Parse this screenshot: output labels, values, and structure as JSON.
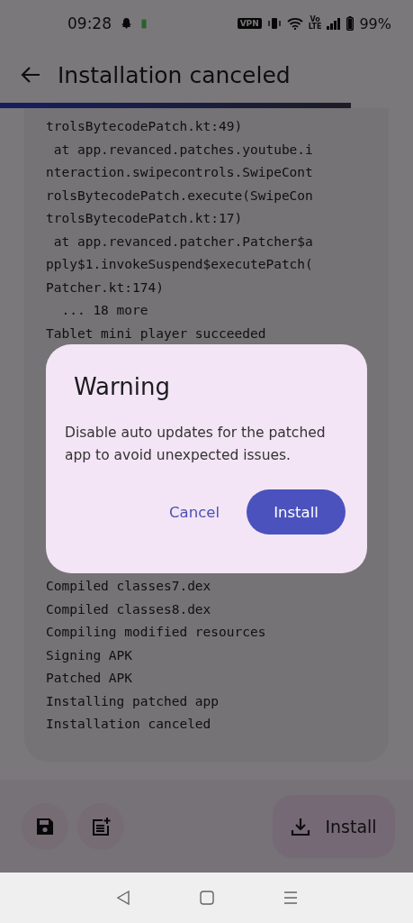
{
  "status_bar": {
    "time": "09:28",
    "vpn": "VPN",
    "volte": "Vo\nLTE",
    "battery": "99%"
  },
  "app_bar": {
    "title": "Installation canceled"
  },
  "progress": {
    "level": 0.85
  },
  "log": {
    "lines_above": [
      "trolsBytecodePatch.kt:49)",
      " at app.revanced.patches.youtube.i",
      "nteraction.swipecontrols.SwipeCont",
      "rolsBytecodePatch.execute(SwipeCon",
      "trolsBytecodePatch.kt:17)",
      " at app.revanced.patcher.Patcher$a",
      "pply$1.invokeSuspend$executePatch(",
      "Patcher.kt:174)",
      "  ... 18 more",
      "Tablet mini player succeeded"
    ],
    "lines_below": [
      "Compiled classes7.dex",
      "Compiled classes8.dex",
      "Compiling modified resources",
      "Signing APK",
      "Patched APK",
      "Installing patched app",
      "Installation canceled"
    ]
  },
  "bottom_bar": {
    "install_button": "Install"
  },
  "dialog": {
    "title": "Warning",
    "message": "Disable auto updates for the patched app to avoid unexpected issues.",
    "buttons": [
      {
        "label": "Cancel",
        "kind": "text"
      },
      {
        "label": "Install",
        "kind": "filled"
      }
    ]
  }
}
